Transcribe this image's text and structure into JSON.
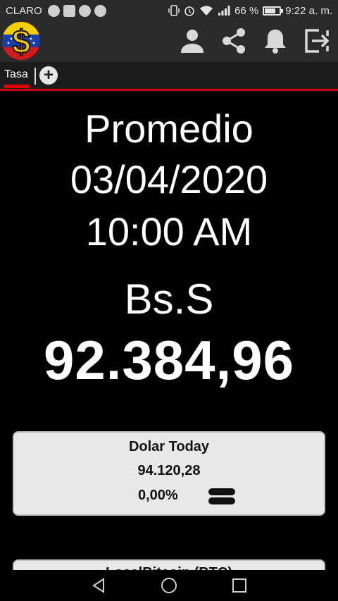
{
  "status_bar": {
    "carrier": "CLARO",
    "battery_text": "66 %",
    "battery_level": 0.66,
    "time": "9:22 a. m."
  },
  "app_bar": {
    "logo_icon": "venezuela-dollar-logo",
    "actions": [
      {
        "icon": "person-icon"
      },
      {
        "icon": "share-icon"
      },
      {
        "icon": "bell-icon"
      },
      {
        "icon": "exit-icon"
      }
    ]
  },
  "tabs": {
    "items": [
      {
        "label": "Tasa"
      }
    ],
    "add_icon": "plus-circle-icon"
  },
  "main": {
    "title": "Promedio",
    "date": "03/04/2020",
    "time": "10:00 AM",
    "currency": "Bs.S",
    "rate": "92.384,96"
  },
  "cards": [
    {
      "title": "Dolar Today",
      "value": "94.120,28",
      "change": "0,00%",
      "trend_icon": "equal-icon"
    },
    {
      "title": "LocalBitcoin (BTC)"
    }
  ],
  "colors": {
    "accent_red": "#e00000",
    "bar_dark": "#2b2b2b",
    "card_bg": "#e8e8e8"
  },
  "nav_bar": {
    "buttons": [
      {
        "icon": "back-icon"
      },
      {
        "icon": "home-icon"
      },
      {
        "icon": "recents-icon"
      }
    ]
  }
}
